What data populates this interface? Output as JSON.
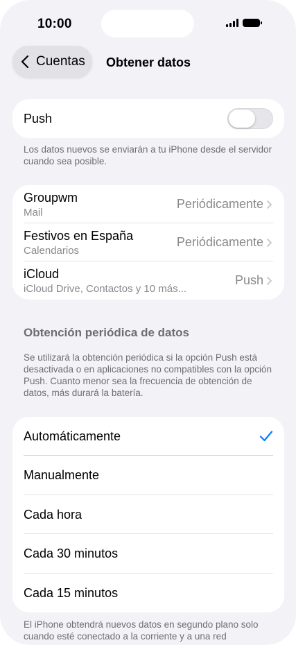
{
  "status_bar": {
    "time": "10:00"
  },
  "nav": {
    "back_label": "Cuentas",
    "title": "Obtener datos"
  },
  "push": {
    "label": "Push",
    "enabled": false,
    "footnote": "Los datos nuevos se enviarán a tu iPhone desde el servidor cuando sea posible."
  },
  "accounts": [
    {
      "name": "Groupwm",
      "subtitle": "Mail",
      "value": "Periódicamente"
    },
    {
      "name": "Festivos en España",
      "subtitle": "Calendarios",
      "value": "Periódicamente"
    },
    {
      "name": "iCloud",
      "subtitle": "iCloud Drive, Contactos y 10 más...",
      "value": "Push"
    }
  ],
  "fetch": {
    "header": "Obtención periódica de datos",
    "description": "Se utilizará la obtención periódica si la opción Push está desactivada o en aplicaciones no compatibles con la opción Push. Cuanto menor sea la frecuencia de obtención de datos, más durará la batería.",
    "options": [
      "Automáticamente",
      "Manualmente",
      "Cada hora",
      "Cada 30 minutos",
      "Cada 15 minutos"
    ],
    "selected": "Automáticamente",
    "footnote": "El iPhone obtendrá nuevos datos en segundo plano solo cuando esté conectado a la corriente y a una red"
  },
  "colors": {
    "accent": "#007aff",
    "background": "#f2f2f7",
    "toggle_off": "#e5e5ea"
  }
}
